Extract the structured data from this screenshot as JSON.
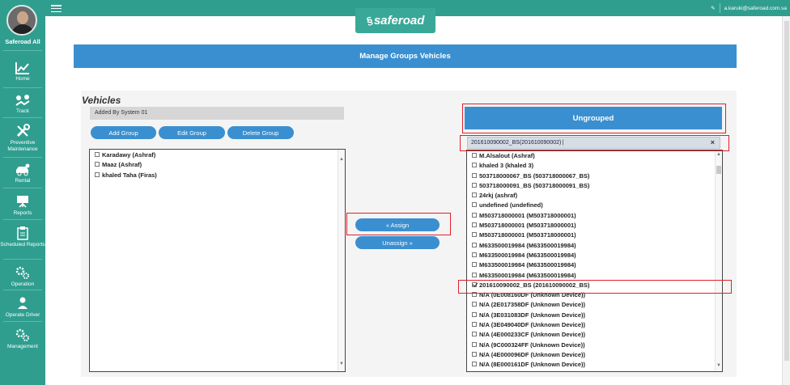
{
  "sidebar": {
    "user_name": "Saferoad All",
    "items": [
      {
        "label": "Home",
        "icon": "home-chart-icon"
      },
      {
        "label": "Track",
        "icon": "track-icon"
      },
      {
        "label": "Preventive Maintenance",
        "icon": "wrench-icon"
      },
      {
        "label": "Rental",
        "icon": "car-rental-icon"
      },
      {
        "label": "Reports",
        "icon": "presentation-icon"
      },
      {
        "label": "Scheduled Reports",
        "icon": "clipboard-icon"
      },
      {
        "label": "Operation",
        "icon": "gears-icon"
      },
      {
        "label": "Operate Driver",
        "icon": "driver-icon"
      },
      {
        "label": "Management",
        "icon": "gears-icon"
      }
    ]
  },
  "topbar": {
    "user_email": "a.karuki@saferoad.com.sa",
    "logo_text": "saferoad"
  },
  "page": {
    "title": "Manage Groups Vehicles",
    "section_title": "Vehicles"
  },
  "left": {
    "group_label": "Added By System 01",
    "buttons": {
      "add": "Add Group",
      "edit": "Edit Group",
      "delete": "Delete Group"
    },
    "vehicles": [
      "Karadawy (Ashraf)",
      "Maaz (Ashraf)",
      "khaled Taha (Firas)"
    ]
  },
  "middle": {
    "assign": "« Assign",
    "unassign": "Unassign »"
  },
  "right": {
    "header": "Ungrouped",
    "selected_tag": "201610090002_BS(201610090002)",
    "vehicles": [
      {
        "label": "M.Alsalout (Ashraf)",
        "checked": false
      },
      {
        "label": "khaled 3 (khaled 3)",
        "checked": false
      },
      {
        "label": "503718000067_BS (503718000067_BS)",
        "checked": false
      },
      {
        "label": "503718000091_BS (503718000091_BS)",
        "checked": false
      },
      {
        "label": "24rkj (ashraf)",
        "checked": false
      },
      {
        "label": "undefined (undefined)",
        "checked": false
      },
      {
        "label": "M503718000001 (M503718000001)",
        "checked": false
      },
      {
        "label": "M503718000001 (M503718000001)",
        "checked": false
      },
      {
        "label": "M503718000001 (M503718000001)",
        "checked": false
      },
      {
        "label": "M633500019984 (M633500019984)",
        "checked": false
      },
      {
        "label": "M633500019984 (M633500019984)",
        "checked": false
      },
      {
        "label": "M633500019984 (M633500019984)",
        "checked": false
      },
      {
        "label": "M633500019984 (M633500019984)",
        "checked": false
      },
      {
        "label": "201610090002_BS (201610090002_BS)",
        "checked": true
      },
      {
        "label": "N/A (0E008160DF (Unknown Device))",
        "checked": false
      },
      {
        "label": "N/A (2E017358DF (Unknown Device))",
        "checked": false
      },
      {
        "label": "N/A (3E031083DF (Unknown Device))",
        "checked": false
      },
      {
        "label": "N/A (3E049040DF (Unknown Device))",
        "checked": false
      },
      {
        "label": "N/A (4E000233CF (Unknown Device))",
        "checked": false
      },
      {
        "label": "N/A (9C000324FF (Unknown Device))",
        "checked": false
      },
      {
        "label": "N/A (4E000096DF (Unknown Device))",
        "checked": false
      },
      {
        "label": "N/A (8E000161DF (Unknown Device))",
        "checked": false
      }
    ]
  }
}
